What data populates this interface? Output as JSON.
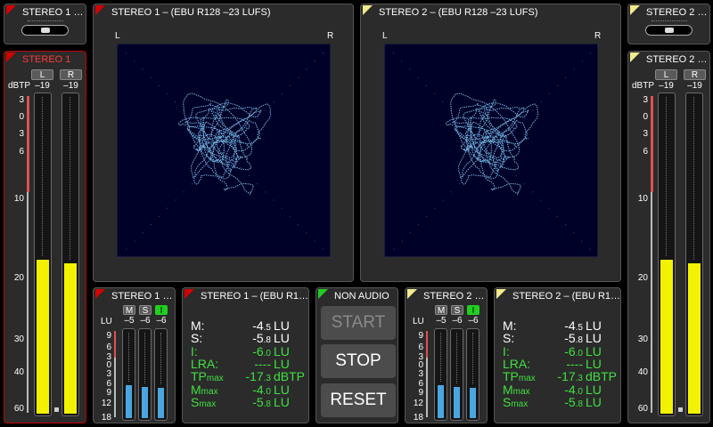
{
  "left_balance": {
    "label": "STEREO 1 …",
    "color": "#d40000"
  },
  "right_balance": {
    "label": "STEREO 2 …",
    "color": "#f2eb8e"
  },
  "left_meter": {
    "label": "STEREO 1",
    "unit": "dBTP",
    "ch_l": "L",
    "ch_r": "R",
    "peak_l": "–19",
    "peak_r": "–19",
    "scale": [
      "3",
      "0",
      "3",
      "6",
      "10",
      "20",
      "30",
      "40",
      "60"
    ],
    "fill_l": 0.48,
    "fill_r": 0.47,
    "fill_color": "#f2f200"
  },
  "right_meter": {
    "label": "STEREO 2 …",
    "unit": "dBTP",
    "ch_l": "L",
    "ch_r": "R",
    "peak_l": "–19",
    "peak_r": "–19",
    "scale": [
      "3",
      "0",
      "3",
      "6",
      "10",
      "20",
      "30",
      "40",
      "60"
    ],
    "fill_l": 0.48,
    "fill_r": 0.47,
    "fill_color": "#f2f200"
  },
  "gonio1": {
    "title": "STEREO 1 – (EBU R128 –23 LUFS)",
    "l": "L",
    "r": "R"
  },
  "gonio2": {
    "title": "STEREO 2 – (EBU R128 –23 LUFS)",
    "l": "L",
    "r": "R"
  },
  "lu_meter1": {
    "title": "STEREO 1 …",
    "unit": "LU",
    "chips": [
      "M",
      "S",
      "I"
    ],
    "values": [
      "–5",
      "–6",
      "–6"
    ],
    "scale": [
      "9",
      "6",
      "3",
      "0",
      "3",
      "6",
      "9",
      "12",
      "18"
    ],
    "fills": [
      0.37,
      0.35,
      0.34
    ],
    "fill_color": "#4aa6e0"
  },
  "lu_meter2": {
    "title": "STEREO 2 …",
    "unit": "LU",
    "chips": [
      "M",
      "S",
      "I"
    ],
    "values": [
      "–5",
      "–6",
      "–6"
    ],
    "scale": [
      "9",
      "6",
      "3",
      "0",
      "3",
      "6",
      "9",
      "12",
      "18"
    ],
    "fills": [
      0.37,
      0.35,
      0.34
    ],
    "fill_color": "#4aa6e0"
  },
  "stats1": {
    "title": "STEREO 1 – (EBU R1…",
    "rows": [
      {
        "label": "M:",
        "label_sub": "",
        "value": "-4",
        "value_sub": ".5",
        "unit": "LU",
        "green": false
      },
      {
        "label": "S:",
        "label_sub": "",
        "value": "-5",
        "value_sub": ".8",
        "unit": "LU",
        "green": false
      },
      {
        "label": "I:",
        "label_sub": "",
        "value": "-6",
        "value_sub": ".0",
        "unit": "LU",
        "green": true
      },
      {
        "label": "LRA:",
        "label_sub": "",
        "value": "----",
        "value_sub": "",
        "unit": "LU",
        "green": true
      },
      {
        "label": "TP",
        "label_sub": "max",
        "value": "-17",
        "value_sub": ".3",
        "unit": "dBTP",
        "green": true
      },
      {
        "label": "M",
        "label_sub": "max",
        "value": "-4",
        "value_sub": ".0",
        "unit": "LU",
        "green": true
      },
      {
        "label": "S",
        "label_sub": "max",
        "value": "-5",
        "value_sub": ".8",
        "unit": "LU",
        "green": true
      }
    ]
  },
  "stats2": {
    "title": "STEREO 2 – (EBU R1…",
    "rows": [
      {
        "label": "M:",
        "label_sub": "",
        "value": "-4",
        "value_sub": ".5",
        "unit": "LU",
        "green": false
      },
      {
        "label": "S:",
        "label_sub": "",
        "value": "-5",
        "value_sub": ".8",
        "unit": "LU",
        "green": false
      },
      {
        "label": "I:",
        "label_sub": "",
        "value": "-6",
        "value_sub": ".0",
        "unit": "LU",
        "green": true
      },
      {
        "label": "LRA:",
        "label_sub": "",
        "value": "----",
        "value_sub": "",
        "unit": "LU",
        "green": true
      },
      {
        "label": "TP",
        "label_sub": "max",
        "value": "-17",
        "value_sub": ".3",
        "unit": "dBTP",
        "green": true
      },
      {
        "label": "M",
        "label_sub": "max",
        "value": "-4",
        "value_sub": ".0",
        "unit": "LU",
        "green": true
      },
      {
        "label": "S",
        "label_sub": "max",
        "value": "-5",
        "value_sub": ".8",
        "unit": "LU",
        "green": true
      }
    ]
  },
  "transport": {
    "title": "NON AUDIO",
    "start": "START",
    "stop": "STOP",
    "reset": "RESET"
  }
}
